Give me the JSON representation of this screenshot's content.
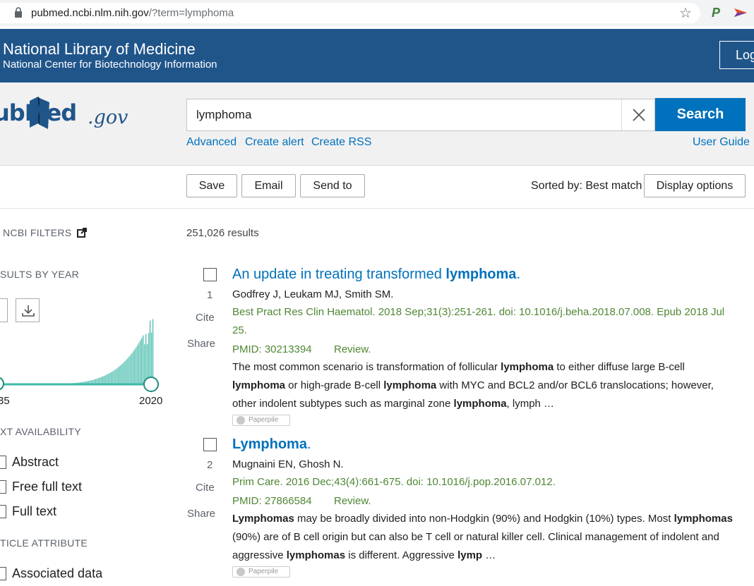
{
  "browser": {
    "url_host": "pubmed.ncbi.nlm.nih.gov",
    "url_path": "/?term=lymphoma"
  },
  "banner": {
    "title": "National Library of Medicine",
    "subtitle": "National Center for Biotechnology Information",
    "login_label": "Log"
  },
  "logo": {
    "main": "ubMed",
    "suffix": ".gov"
  },
  "search": {
    "query": "lymphoma",
    "button_label": "Search",
    "links": [
      "Advanced",
      "Create alert",
      "Create RSS"
    ],
    "user_guide": "User Guide"
  },
  "toolbar": {
    "save": "Save",
    "email": "Email",
    "send_to": "Send to",
    "sorted_by": "Sorted by: Best match",
    "display_options": "Display options"
  },
  "sidebar": {
    "ncbi_filters": "NCBI FILTERS",
    "results_by_year": "SULTS BY YEAR",
    "year_start": "35",
    "year_end": "2020",
    "text_availability": "XT AVAILABILITY",
    "text_options": [
      "Abstract",
      "Free full text",
      "Full text"
    ],
    "article_attribute": "TICLE ATTRIBUTE",
    "attribute_options": [
      "Associated data"
    ]
  },
  "results": {
    "count": "251,026 results",
    "cite_label": "Cite",
    "share_label": "Share",
    "paperpile_label": "Paperpile",
    "items": [
      {
        "num": "1",
        "title_pre": "An update in treating transformed ",
        "title_bold": "lymphoma",
        "title_post": ".",
        "authors": "Godfrey J, Leukam MJ, Smith SM.",
        "citation": "Best Pract Res Clin Haematol. 2018 Sep;31(3):251-261. doi: 10.1016/j.beha.2018.07.008. Epub 2018 Jul 25.",
        "pmid": "PMID: 30213394",
        "type": "Review.",
        "snippet": [
          {
            "t": "The most common scenario is transformation of follicular ",
            "b": false
          },
          {
            "t": "lymphoma",
            "b": true
          },
          {
            "t": " to either diffuse large B-cell ",
            "b": false
          },
          {
            "t": "lymphoma",
            "b": true
          },
          {
            "t": " or high-grade B-cell ",
            "b": false
          },
          {
            "t": "lymphoma",
            "b": true
          },
          {
            "t": " with MYC and BCL2 and/or BCL6 translocations; however, other indolent subtypes such as marginal zone ",
            "b": false
          },
          {
            "t": "lymphoma",
            "b": true
          },
          {
            "t": ", lymph …",
            "b": false
          }
        ]
      },
      {
        "num": "2",
        "title_pre": "",
        "title_bold": "Lymphoma",
        "title_post": ".",
        "authors": "Mugnaini EN, Ghosh N.",
        "citation": "Prim Care. 2016 Dec;43(4):661-675. doi: 10.1016/j.pop.2016.07.012.",
        "pmid": "PMID: 27866584",
        "type": "Review.",
        "snippet": [
          {
            "t": "Lymphomas",
            "b": true
          },
          {
            "t": " may be broadly divided into non-Hodgkin (90%) and Hodgkin (10%) types. Most ",
            "b": false
          },
          {
            "t": "lymphomas",
            "b": true
          },
          {
            "t": " (90%) are of B cell origin but can also be T cell or natural killer cell. Clinical management of indolent and aggressive ",
            "b": false
          },
          {
            "t": "lymphomas",
            "b": true
          },
          {
            "t": " is different. Aggressive ",
            "b": false
          },
          {
            "t": "lymp",
            "b": true
          },
          {
            "t": " …",
            "b": false
          }
        ]
      }
    ]
  },
  "colors": {
    "brand": "#20558a",
    "accent": "#0071bc",
    "citation": "#4f8734",
    "histogram": "#3eb8a9"
  }
}
